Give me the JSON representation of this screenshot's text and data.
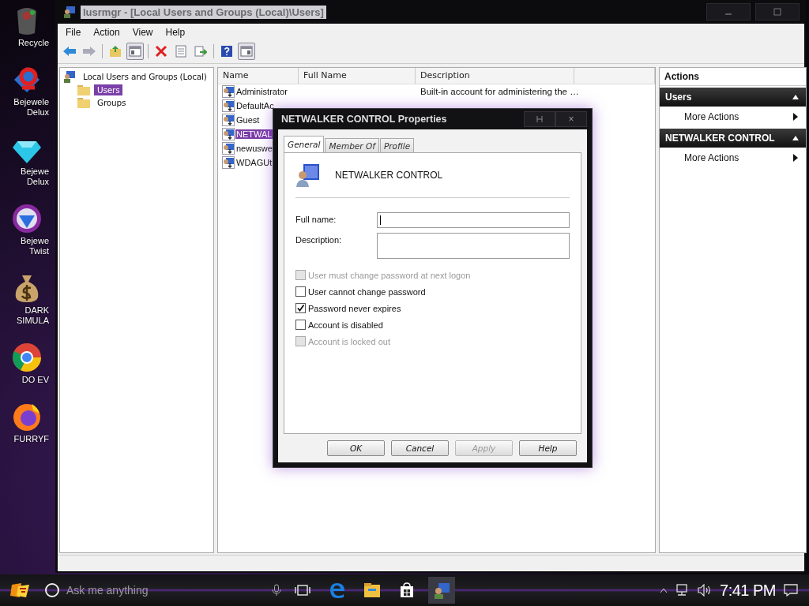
{
  "desktop_icons": [
    {
      "kind": "recycle",
      "lines": [
        "Recycle"
      ]
    },
    {
      "kind": "bejeweled",
      "lines": [
        "Bejewele",
        "Delux"
      ]
    },
    {
      "kind": "diamond",
      "lines": [
        "Bejewe",
        "Delux"
      ]
    },
    {
      "kind": "twist",
      "lines": [
        "Bejewe",
        "Twist"
      ]
    },
    {
      "kind": "money",
      "lines": [
        "DARK",
        "SIMULA"
      ]
    },
    {
      "kind": "chrome",
      "lines": [
        "DO EV"
      ]
    },
    {
      "kind": "firefox",
      "lines": [
        "FURRYF"
      ]
    }
  ],
  "window": {
    "title": "lusrmgr - [Local Users and Groups (Local)\\Users]",
    "menu": [
      "File",
      "Action",
      "View",
      "Help"
    ],
    "tree": {
      "label": "Local Users and Groups (Local)",
      "children": [
        {
          "label": "Users",
          "selected": true
        },
        {
          "label": "Groups",
          "selected": false
        }
      ]
    },
    "list": {
      "columns": [
        "Name",
        "Full Name",
        "Description"
      ],
      "rows": [
        {
          "name": "Administrator",
          "description": "Built-in account for administering the …",
          "selected": false
        },
        {
          "name": "DefaultAc",
          "selected": false
        },
        {
          "name": "Guest",
          "selected": false
        },
        {
          "name": "NETWAL",
          "selected": true
        },
        {
          "name": "newuswe",
          "selected": false
        },
        {
          "name": "WDAGUt",
          "selected": false
        }
      ]
    },
    "actions": {
      "title": "Actions",
      "sections": [
        {
          "title": "Users",
          "items": [
            "More Actions"
          ]
        },
        {
          "title": "NETWALKER CONTROL",
          "items": [
            "More Actions"
          ]
        }
      ]
    }
  },
  "dialog": {
    "title": "NETWALKER CONTROL Properties",
    "close": "×",
    "tabs": [
      {
        "label": "General",
        "selected": true
      },
      {
        "label": "Member Of",
        "selected": false
      },
      {
        "label": "Profile",
        "selected": false
      }
    ],
    "user_name": "NETWALKER CONTROL",
    "fields": [
      {
        "label": "Full name:",
        "kind": "line",
        "focused": true
      },
      {
        "label": "Description:",
        "kind": "box",
        "focused": false
      }
    ],
    "options": [
      {
        "label": "User must change password at next logon",
        "checked": false,
        "disabled": true
      },
      {
        "label": "User cannot change password",
        "checked": false,
        "disabled": false
      },
      {
        "label": "Password never expires",
        "checked": true,
        "disabled": false
      },
      {
        "label": "Account is disabled",
        "checked": false,
        "disabled": false
      },
      {
        "label": "Account is locked out",
        "checked": false,
        "disabled": true
      }
    ],
    "buttons": [
      {
        "label": "OK",
        "disabled": false
      },
      {
        "label": "Cancel",
        "disabled": false
      },
      {
        "label": "Apply",
        "disabled": true
      },
      {
        "label": "Help",
        "disabled": false
      }
    ]
  },
  "taskbar": {
    "search": {
      "placeholder": "Ask me anything"
    },
    "apps": [
      {
        "kind": "edge",
        "selected": false
      },
      {
        "kind": "explorer",
        "selected": false
      },
      {
        "kind": "store",
        "selected": false
      },
      {
        "kind": "users",
        "selected": true
      }
    ],
    "clock": "7:41 PM"
  }
}
